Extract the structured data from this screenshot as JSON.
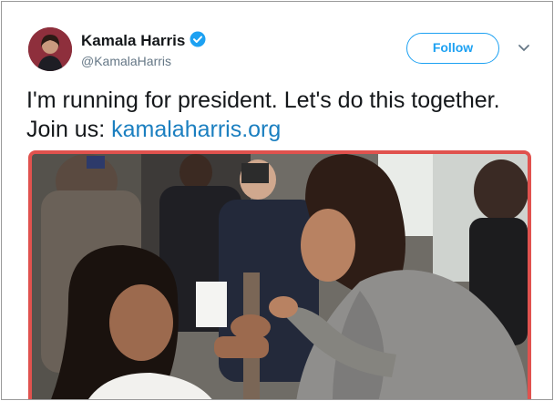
{
  "author": {
    "name": "Kamala Harris",
    "handle": "@KamalaHarris",
    "verified_icon": "verified-badge-icon",
    "avatar_icon": "profile-avatar"
  },
  "actions": {
    "follow_label": "Follow",
    "menu_icon": "chevron-down-icon"
  },
  "tweet": {
    "text": "I'm running for president. Let's do this together. Join us: ",
    "link_text": "kamalaharris.org"
  },
  "media": {
    "type": "photo",
    "description_icon": "tweet-photo"
  },
  "colors": {
    "accent": "#1da1f2",
    "link": "#1b7fc0",
    "media_border": "#e0524e",
    "text": "#14171a",
    "muted": "#657786"
  }
}
